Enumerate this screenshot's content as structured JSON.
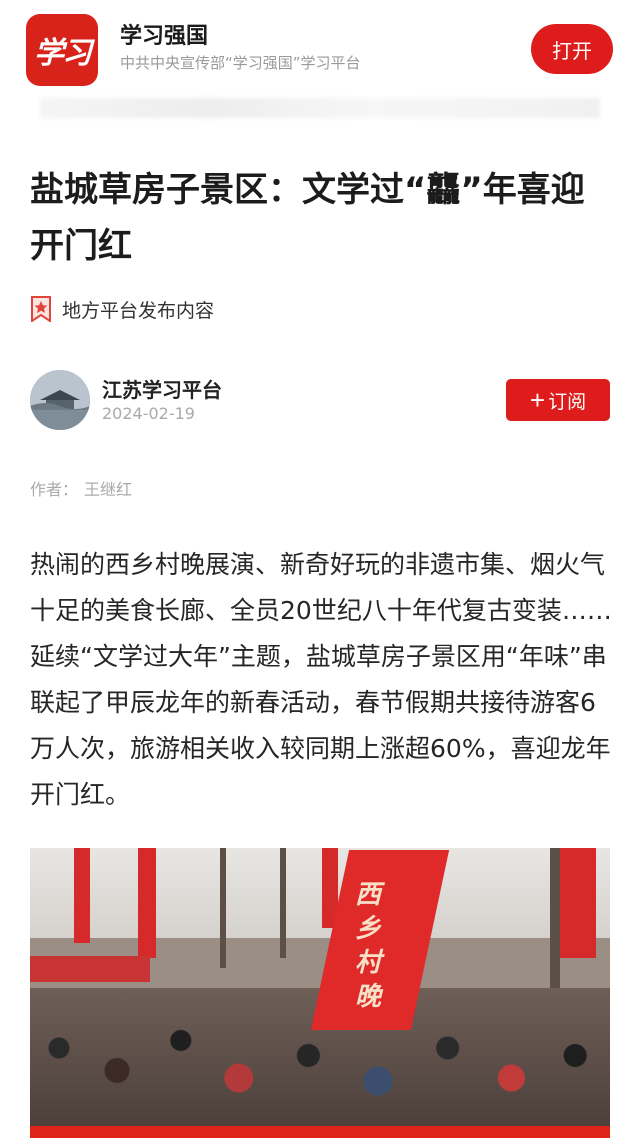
{
  "app_banner": {
    "logo_text": "学习",
    "app_name": "学习强国",
    "app_subtitle": "中共中央宣传部“学习强国”学习平台",
    "open_button": "打开"
  },
  "article": {
    "title": "盐城草房子景区：文学过“龘”年喜迎开门红",
    "source_label": "地方平台发布内容",
    "publisher": "江苏学习平台",
    "date": "2024-02-19",
    "subscribe_plus": "+",
    "subscribe_label": "订阅",
    "byline_prefix": "作者：",
    "author": "王继红",
    "body": "热闹的西乡村晚展演、新奇好玩的非遗市集、烟火气十足的美食长廊、全员20世纪八十年代复古变装……延续“文学过大年”主题，盐城草房子景区用“年味”串联起了甲辰龙年的新春活动，春节假期共接待游客6万人次，旅游相关收入较同期上涨超60%，喜迎龙年开门红。",
    "photo_banner_text": "西乡村晚"
  },
  "colors": {
    "brand_red": "#de1c1c",
    "secondary_text": "#999999"
  },
  "icons": {
    "source": "star-ribbon-icon"
  }
}
